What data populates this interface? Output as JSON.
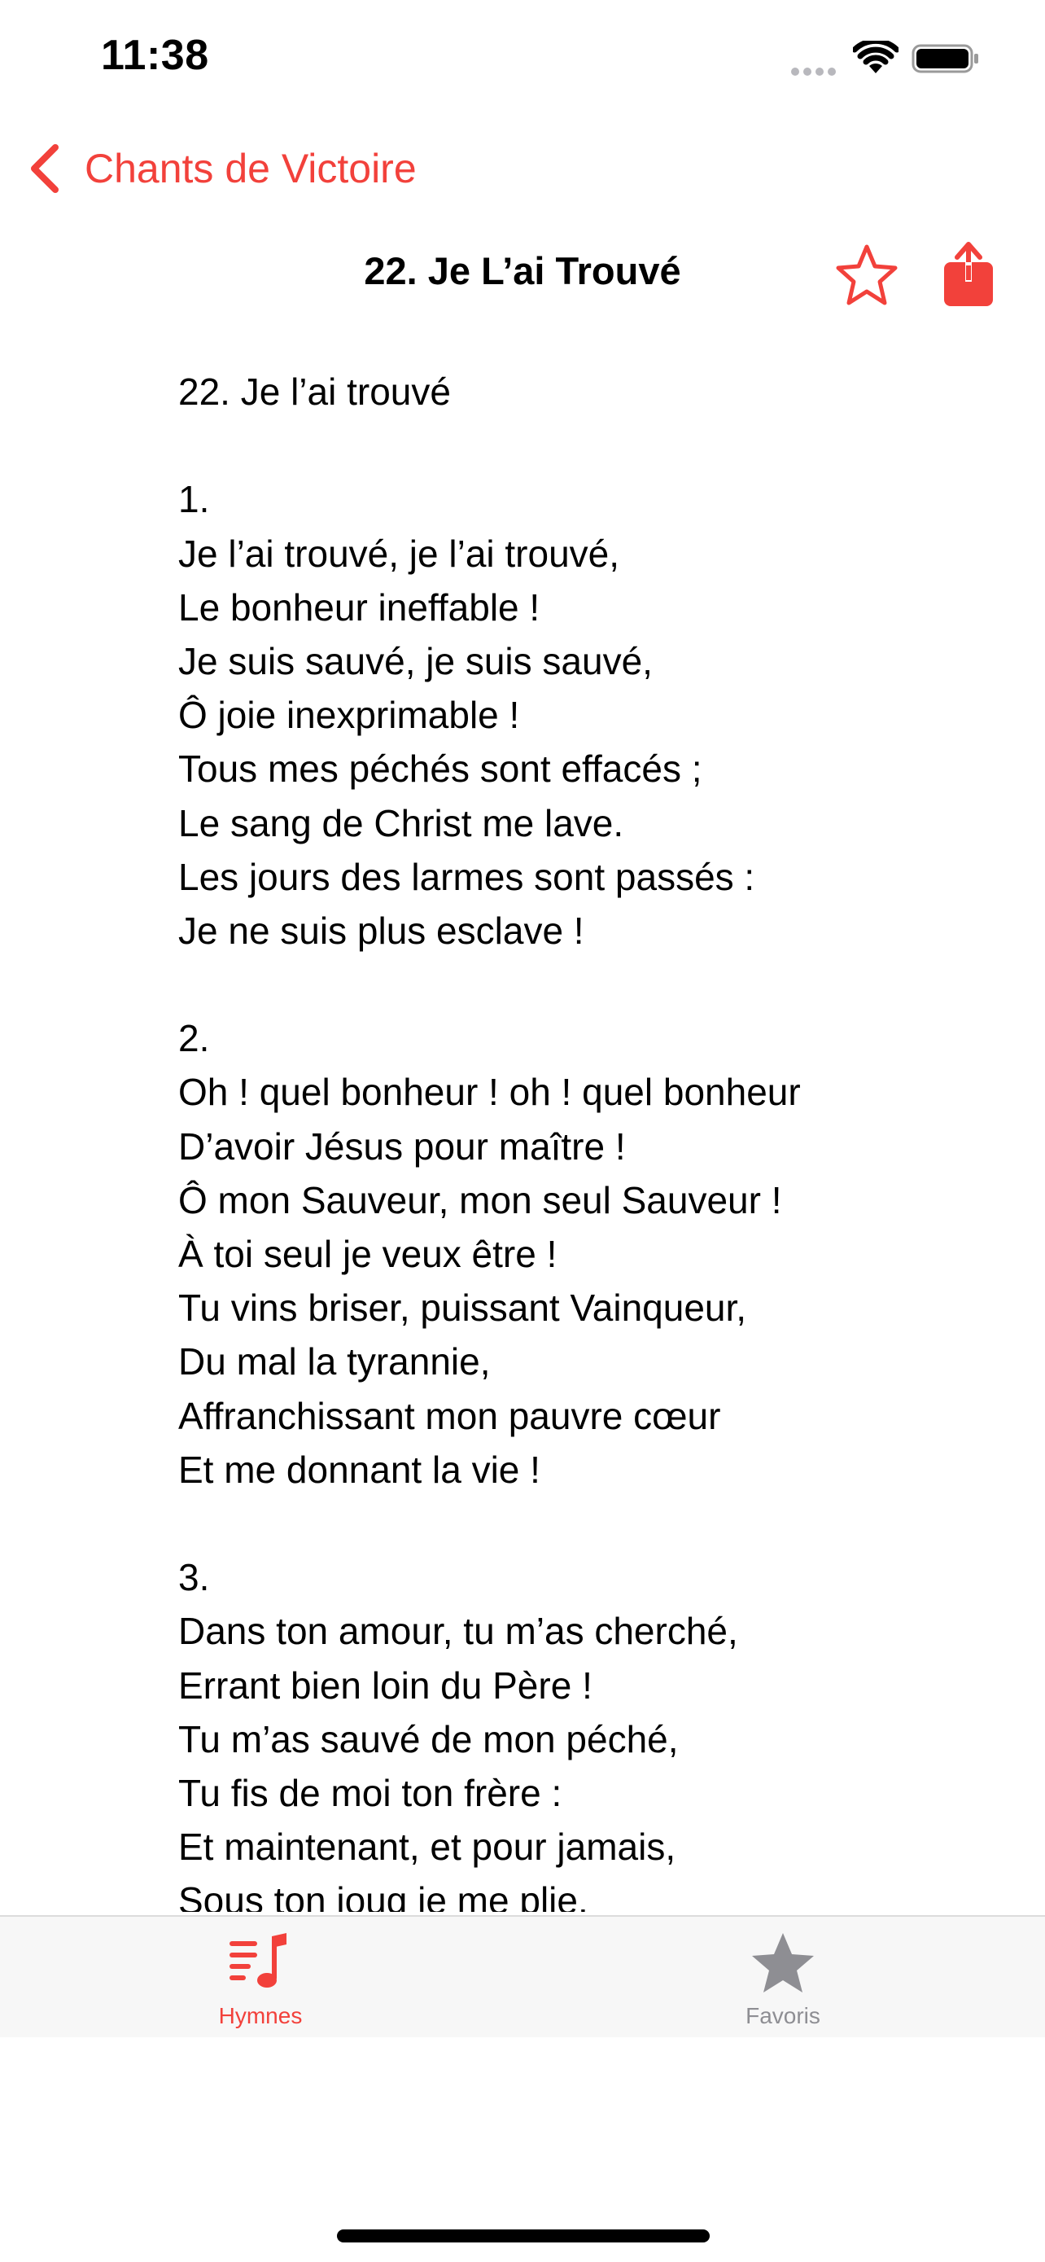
{
  "status_bar": {
    "time": "11:38"
  },
  "nav": {
    "back_label": "Chants de Victoire",
    "title": "22. Je L’ai Trouvé",
    "accent_color": "#f2413b"
  },
  "icons": {
    "back": "chevron-left-icon",
    "favorite": "star-outline-icon",
    "share": "share-icon",
    "hymnes_tab": "music-list-icon",
    "favoris_tab": "star-filled-icon"
  },
  "lyrics": [
    "22. Je l’ai trouvé",
    "",
    "1.",
    "Je l’ai trouvé, je l’ai trouvé,",
    "Le bonheur ineffable !",
    "Je suis sauvé, je suis sauvé,",
    "Ô joie inexprimable !",
    "Tous mes péchés sont effacés ;",
    "Le sang de Christ me lave.",
    "Les jours des larmes sont passés :",
    "Je ne suis plus esclave !",
    "",
    "2.",
    "Oh ! quel bonheur ! oh ! quel bonheur",
    "D’avoir Jésus pour maître !",
    "Ô mon Sauveur, mon seul Sauveur !",
    "À toi seul je veux être !",
    "Tu vins briser, puissant Vainqueur,",
    "Du mal la tyrannie,",
    "Affranchissant mon pauvre cœur",
    "Et me donnant la vie !",
    "",
    "3.",
    "Dans ton amour, tu m’as cherché,",
    "Errant bien loin du Père !",
    "Tu m’as sauvé de mon péché,",
    "Tu fis de moi ton frère :",
    "Et maintenant, et pour jamais,",
    "Sous ton joug je me plie."
  ],
  "tabs": [
    {
      "label": "Hymnes",
      "selected": true
    },
    {
      "label": "Favoris",
      "selected": false
    }
  ]
}
